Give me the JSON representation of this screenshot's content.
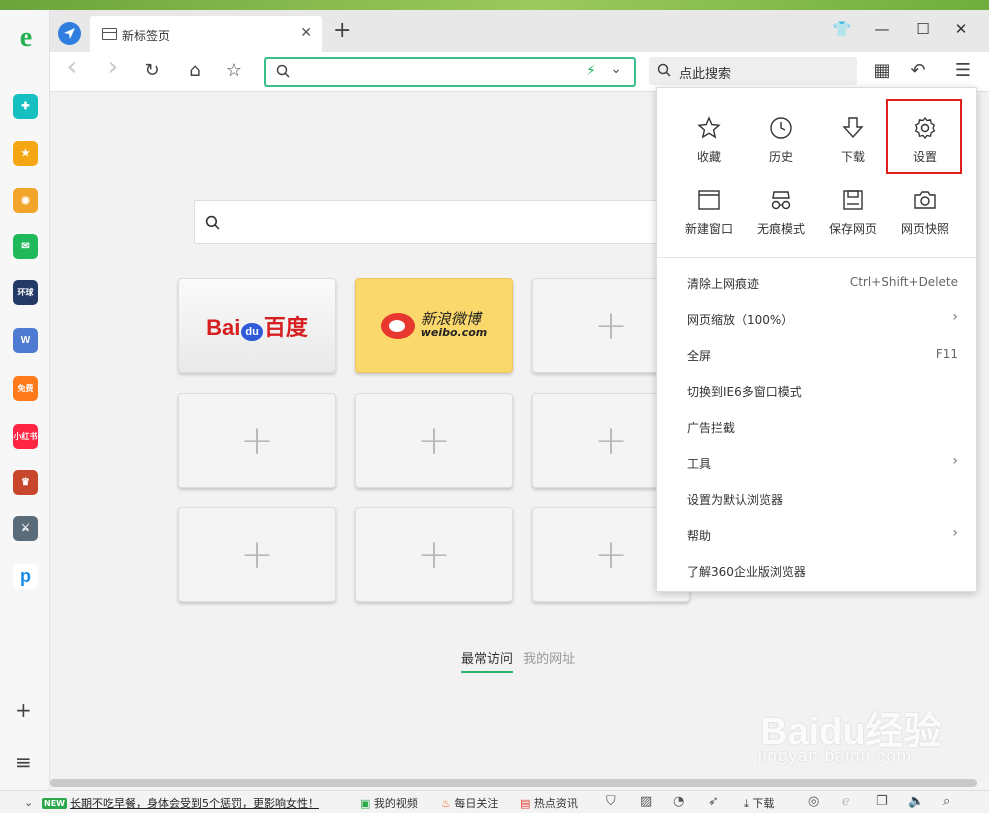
{
  "tab": {
    "title": "新标签页"
  },
  "window_controls": {
    "skin": "👕",
    "minimize": "—",
    "maximize": "☐",
    "close": "✕"
  },
  "toolbar": {
    "back": "‹",
    "forward": "›",
    "refresh": "↻",
    "home": "⌂",
    "favorite": "☆",
    "search_placeholder": "点此搜索",
    "undo": "↶",
    "grid": "▦",
    "menu": "☰"
  },
  "sidebar": {
    "logo": "e",
    "items": [
      {
        "name": "medical",
        "text": "✚",
        "color": "#17c0c0"
      },
      {
        "name": "favorites",
        "text": "★",
        "color": "#f4a712"
      },
      {
        "name": "weibo",
        "text": "◉",
        "color": "#f2a42b"
      },
      {
        "name": "mail",
        "text": "✉",
        "color": "#1fb959"
      },
      {
        "name": "game-a",
        "text": "环球",
        "color": "#243a66"
      },
      {
        "name": "word",
        "text": "W",
        "color": "#4e7bd1"
      },
      {
        "name": "novel",
        "text": "免费",
        "color": "#ff7a1a"
      },
      {
        "name": "xiaohongshu",
        "text": "小红书",
        "color": "#ff2442"
      },
      {
        "name": "game-b",
        "text": "♛",
        "color": "#c8462b"
      },
      {
        "name": "game-c",
        "text": "⚔",
        "color": "#5a6b7a"
      },
      {
        "name": "pdd",
        "text": "p",
        "color": "#ffffff"
      }
    ],
    "add": "+",
    "list": "≡"
  },
  "tiles": {
    "baidu": {
      "left": "Bai",
      "paw": "du",
      "right": "百度"
    },
    "weibo": {
      "cn": "新浪微博",
      "en": "weibo.com"
    },
    "plus": "+"
  },
  "bottom_tabs": {
    "frequent": "最常访问",
    "my_sites": "我的网址"
  },
  "menu": {
    "icons": [
      {
        "label": "收藏"
      },
      {
        "label": "历史"
      },
      {
        "label": "下载"
      },
      {
        "label": "设置"
      },
      {
        "label": "新建窗口"
      },
      {
        "label": "无痕模式"
      },
      {
        "label": "保存网页"
      },
      {
        "label": "网页快照"
      }
    ],
    "rows": [
      {
        "label": "清除上网痕迹",
        "shortcut": "Ctrl+Shift+Delete"
      },
      {
        "label": "网页缩放（100%）",
        "arrow": "›"
      },
      {
        "label": "全屏",
        "shortcut": "F11"
      },
      {
        "label": "切换到IE6多窗口模式"
      },
      {
        "label": "广告拦截"
      },
      {
        "label": "工具",
        "arrow": "›"
      },
      {
        "label": "设置为默认浏览器"
      },
      {
        "label": "帮助",
        "arrow": "›"
      },
      {
        "label": "了解360企业版浏览器"
      }
    ]
  },
  "status": {
    "new_badge": "NEW",
    "news": "长期不吃早餐，身体会受到5个惩罚，更影响女性！",
    "my_video": "我的视频",
    "daily": "每日关注",
    "hot": "热点资讯",
    "download": "下载"
  },
  "watermark": {
    "big": "Baidu经验",
    "small": "jingyan.baidu.com"
  }
}
